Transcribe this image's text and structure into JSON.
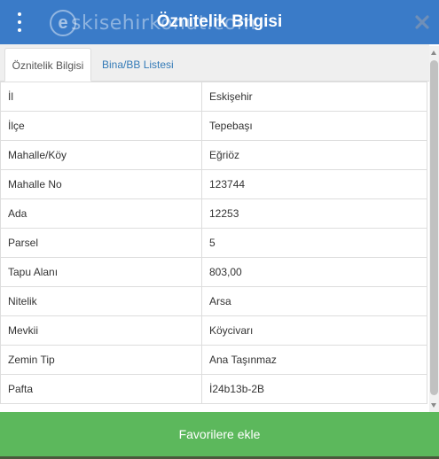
{
  "header": {
    "title": "Öznitelik Bilgisi",
    "watermark_letter": "e",
    "watermark_text": "skisehirkonut.com",
    "background": "#3a7bc8"
  },
  "tabs": [
    {
      "label": "Öznitelik Bilgisi",
      "active": true
    },
    {
      "label": "Bina/BB Listesi",
      "active": false
    }
  ],
  "attributes": [
    {
      "key": "İl",
      "value": "Eskişehir"
    },
    {
      "key": "İlçe",
      "value": "Tepebaşı"
    },
    {
      "key": "Mahalle/Köy",
      "value": "Eğriöz"
    },
    {
      "key": "Mahalle No",
      "value": "123744"
    },
    {
      "key": "Ada",
      "value": "12253"
    },
    {
      "key": "Parsel",
      "value": "5"
    },
    {
      "key": "Tapu Alanı",
      "value": "803,00"
    },
    {
      "key": "Nitelik",
      "value": "Arsa"
    },
    {
      "key": "Mevkii",
      "value": "Köycivarı"
    },
    {
      "key": "Zemin Tip",
      "value": "Ana Taşınmaz"
    },
    {
      "key": "Pafta",
      "value": "İ24b13b-2B"
    }
  ],
  "footer": {
    "button_label": "Favorilere ekle",
    "background": "#5cb85c"
  },
  "icons": {
    "menu": "vertical-dots-icon",
    "close": "close-icon"
  }
}
